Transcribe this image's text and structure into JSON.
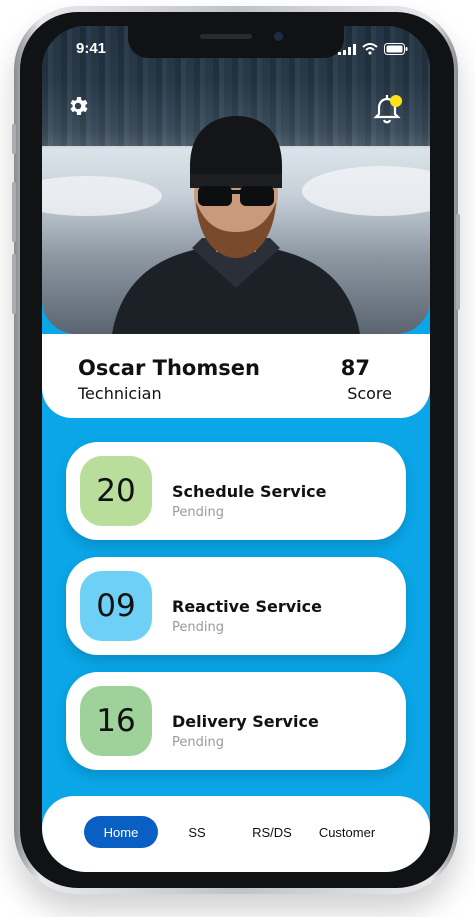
{
  "status_bar": {
    "time": "9:41"
  },
  "profile": {
    "name": "Oscar Thomsen",
    "role": "Technician",
    "score": "87",
    "score_label": "Score"
  },
  "services": [
    {
      "count": "20",
      "title": "Schedule Service",
      "status": "Pending",
      "color": "#b9dd9b"
    },
    {
      "count": "09",
      "title": "Reactive Service",
      "status": "Pending",
      "color": "#6fd0f5"
    },
    {
      "count": "16",
      "title": "Delivery Service",
      "status": "Pending",
      "color": "#9fd29a"
    }
  ],
  "nav": [
    {
      "label": "Home",
      "active": true
    },
    {
      "label": "SS"
    },
    {
      "label": "RS/DS"
    },
    {
      "label": "Customer"
    }
  ],
  "colors": {
    "accent": "#0a5fc4",
    "background": "#0aa6e8",
    "notification_dot": "#ffe11a"
  },
  "icons": [
    "gear-icon",
    "bell-icon",
    "signal-icon",
    "wifi-icon",
    "battery-icon"
  ]
}
